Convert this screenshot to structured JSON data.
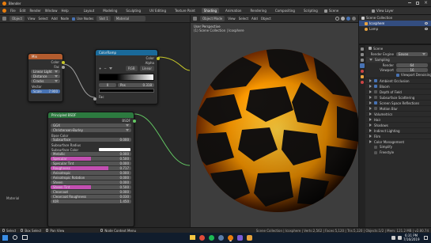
{
  "titlebar": {
    "app": "Blender"
  },
  "menubar": {
    "menus": [
      "File",
      "Edit",
      "Render",
      "Window",
      "Help"
    ],
    "workspaces": [
      "Layout",
      "Modeling",
      "Sculpting",
      "UV Editing",
      "Texture Paint",
      "Shading",
      "Animation",
      "Rendering",
      "Compositing",
      "Scripting"
    ],
    "active_workspace": "Shading",
    "scene": "Scene",
    "view_layer": "View Layer"
  },
  "node_header": {
    "object": "Object",
    "items": [
      "View",
      "Select",
      "Add",
      "Node"
    ],
    "use_nodes": "Use Nodes",
    "slot": "Slot 1",
    "material": "Material"
  },
  "viewport_header": {
    "items": [
      "Object Mode",
      "View",
      "Select",
      "Add",
      "Object"
    ]
  },
  "viewport": {
    "title": "User Perspective",
    "subtitle": "(1) Scene Collection | Icosphere"
  },
  "nodes": {
    "mix": {
      "title": "Mix",
      "outputs": [
        "Color",
        "Fac"
      ],
      "fields": [
        "Linear Light",
        "Distance",
        "Cracks"
      ],
      "scale_label": "Scale",
      "scale_value": "7.900",
      "input": "Vector"
    },
    "colorramp": {
      "title": "ColorRamp",
      "outputs": [
        "Color",
        "Alpha"
      ],
      "mode": "RGB",
      "interp": "Linear",
      "pos_label": "Pos",
      "index": "0",
      "pos_value": "0.318",
      "input": "Fac"
    },
    "principled": {
      "title": "Principled BSDF",
      "output": "BSDF",
      "distribution": "GGX",
      "subsurface_method": "Christensen-Burley",
      "rows": [
        {
          "label": "Base Color",
          "value": ""
        },
        {
          "label": "Subsurface",
          "value": "0.000"
        },
        {
          "label": "Subsurface Radius",
          "value": ""
        },
        {
          "label": "Subsurface Color",
          "value": ""
        },
        {
          "label": "Metallic",
          "value": "0.000"
        },
        {
          "label": "Specular",
          "value": "0.500"
        },
        {
          "label": "Specular Tint",
          "value": "0.000"
        },
        {
          "label": "Roughness",
          "value": "0.717"
        },
        {
          "label": "Anisotropic",
          "value": "0.000"
        },
        {
          "label": "Anisotropic Rotation",
          "value": "0.000"
        },
        {
          "label": "Sheen",
          "value": "0.000"
        },
        {
          "label": "Sheen Tint",
          "value": "0.500"
        },
        {
          "label": "Clearcoat",
          "value": "0.000"
        },
        {
          "label": "Clearcoat Roughness",
          "value": "0.030"
        },
        {
          "label": "IOR",
          "value": "1.450"
        }
      ]
    },
    "material_label": "Material"
  },
  "outliner": {
    "title": "Scene Collection",
    "items": [
      "Icosphere",
      "Lamp"
    ]
  },
  "properties": {
    "tab": "Scene",
    "render_engine_label": "Render Engine",
    "render_engine": "Eevee",
    "sampling": "Sampling",
    "render_label": "Render",
    "render_value": "64",
    "viewport_label": "Viewport",
    "viewport_value": "16",
    "viewport_denoising": "Viewport Denoising",
    "sections": [
      "Ambient Occlusion",
      "Bloom",
      "Depth of Field",
      "Subsurface Scattering",
      "Screen Space Reflections",
      "Motion Blur",
      "Volumetrics",
      "Hair",
      "Shadows",
      "Indirect Lighting",
      "Film",
      "Color Management"
    ],
    "checked": [
      true,
      true,
      false,
      false,
      true,
      false,
      false,
      false,
      false,
      false,
      false,
      false
    ],
    "color_mgmt_rows": [
      "Simplify",
      "Freestyle"
    ]
  },
  "statusbar": {
    "items": [
      "Select",
      "Box Select",
      "Pan View",
      "Node Context Menu"
    ],
    "stats": "Scene Collection | Icosphere | Verts:2,562 | Faces:5,120 | Tris:5,120 | Objects:1/2 | Mem: 121.2 MB | v2.80.74"
  },
  "taskbar": {
    "time": "6:31 PM",
    "date": "7/16/2019"
  },
  "colors": {
    "mix_header": "#b35c2e",
    "colorramp_header": "#1a6a9a",
    "principled_header": "#2c7a3f",
    "accent": "#4772b3",
    "magma": "#ffb000"
  }
}
